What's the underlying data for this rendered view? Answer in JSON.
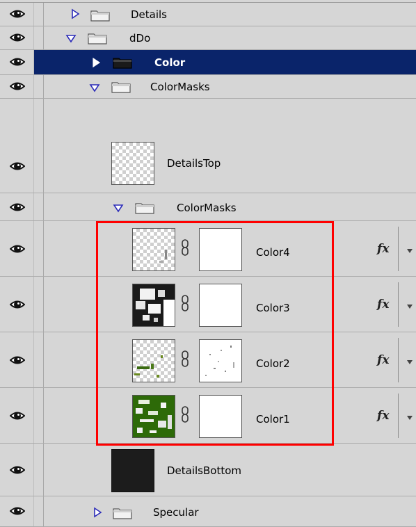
{
  "layers": [
    {
      "label": "Details",
      "type": "group",
      "expanded": false
    },
    {
      "label": "dDo",
      "type": "group",
      "expanded": true
    },
    {
      "label": "Color",
      "type": "group",
      "expanded": false,
      "selected": true
    },
    {
      "label": "ColorMasks",
      "type": "group",
      "expanded": true
    },
    {
      "label": "DetailsTop",
      "type": "layer"
    },
    {
      "label": "ColorMasks",
      "type": "group",
      "expanded": true
    },
    {
      "label": "Color4",
      "type": "masked-layer",
      "effects": "fx"
    },
    {
      "label": "Color3",
      "type": "masked-layer",
      "effects": "fx"
    },
    {
      "label": "Color2",
      "type": "masked-layer",
      "effects": "fx"
    },
    {
      "label": "Color1",
      "type": "masked-layer",
      "effects": "fx"
    },
    {
      "label": "DetailsBottom",
      "type": "layer"
    },
    {
      "label": "Specular",
      "type": "group",
      "expanded": false
    }
  ],
  "colors": {
    "selection": "#0a246a",
    "panel": "#d6d6d6",
    "highlight_box": "#ff0000",
    "thumb_green": "#2d6a08"
  },
  "icons": {
    "visibility": "eye-icon",
    "group": "folder-icon",
    "collapsed": "triangle-right-icon",
    "expanded": "triangle-down-icon",
    "mask_link": "chain-link-icon",
    "effects_menu": "chevron-down-icon"
  }
}
